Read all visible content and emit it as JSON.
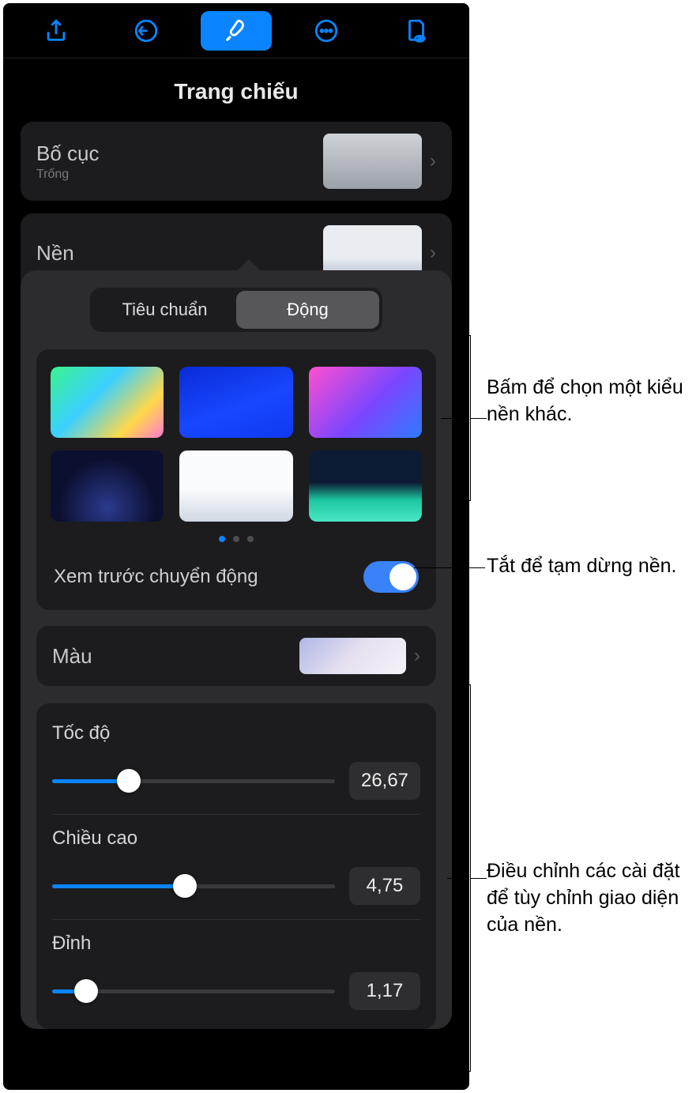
{
  "title": "Trang chiếu",
  "layout": {
    "label": "Bố cục",
    "sub": "Trống"
  },
  "background_row": {
    "label": "Nền"
  },
  "segmented": {
    "standard": "Tiêu chuẩn",
    "dynamic": "Động"
  },
  "preview_motion": {
    "label": "Xem trước chuyển động",
    "on": true
  },
  "color_row": {
    "label": "Màu"
  },
  "sliders": {
    "speed": {
      "label": "Tốc độ",
      "value": "26,67",
      "pct": 27
    },
    "height": {
      "label": "Chiều cao",
      "value": "4,75",
      "pct": 47
    },
    "peak": {
      "label": "Đỉnh",
      "value": "1,17",
      "pct": 12
    }
  },
  "callouts": {
    "pick_bg": "Bấm để chọn một kiểu nền khác.",
    "toggle": "Tắt để tạm dừng nền.",
    "sliders": "Điều chỉnh các cài đặt để tùy chỉnh giao diện của nền."
  }
}
